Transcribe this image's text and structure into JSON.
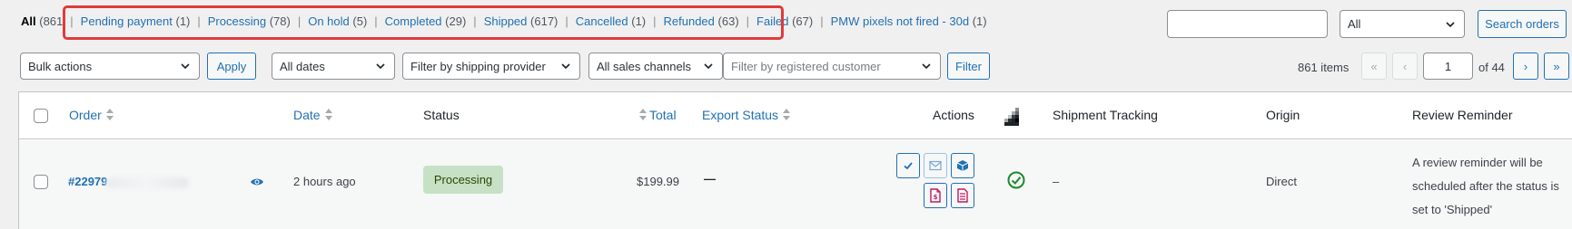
{
  "status_filters": {
    "all": {
      "label": "All",
      "count": "(861"
    },
    "items": [
      {
        "label": "Pending payment",
        "count": "(1)"
      },
      {
        "label": "Processing",
        "count": "(78)"
      },
      {
        "label": "On hold",
        "count": "(5)"
      },
      {
        "label": "Completed",
        "count": "(29)"
      },
      {
        "label": "Shipped",
        "count": "(617)"
      },
      {
        "label": "Cancelled",
        "count": "(1)"
      },
      {
        "label": "Refunded",
        "count": "(63)"
      },
      {
        "label": "Failed",
        "count": "(67)"
      },
      {
        "label": "PMW pixels not fired - 30d",
        "count": "(1)"
      }
    ],
    "separator": "|"
  },
  "search": {
    "value": "",
    "type_select": "All",
    "button_label": "Search orders"
  },
  "tablenav": {
    "bulk_actions": "Bulk actions",
    "apply_label": "Apply",
    "dates": "All dates",
    "shipping_provider": "Filter by shipping provider",
    "sales_channels": "All sales channels",
    "customer_placeholder": "Filter by registered customer",
    "filter_label": "Filter"
  },
  "pagination": {
    "items": "861 items",
    "first": "«",
    "prev": "‹",
    "current_page": "1",
    "of_pages": "of 44",
    "next": "›",
    "last": "»"
  },
  "columns": {
    "order": "Order",
    "date": "Date",
    "status": "Status",
    "total": "Total",
    "export_status": "Export Status",
    "actions": "Actions",
    "shipment_tracking": "Shipment Tracking",
    "origin": "Origin",
    "review_reminder": "Review Reminder"
  },
  "orders": [
    {
      "number": "#22979",
      "date": "2 hours ago",
      "status": "Processing",
      "total": "$199.99",
      "export_status": "—",
      "shipment_tracking": "–",
      "origin": "Direct",
      "review_reminder": "A review reminder will be scheduled after the status is set to 'Shipped'"
    }
  ],
  "colors": {
    "link": "#2271b1",
    "highlight": "#e03b3b",
    "processing_bg": "#c6e1c6",
    "processing_text": "#2c4700",
    "check_green": "#1a8a2b",
    "pdf_magenta": "#c2185b"
  }
}
